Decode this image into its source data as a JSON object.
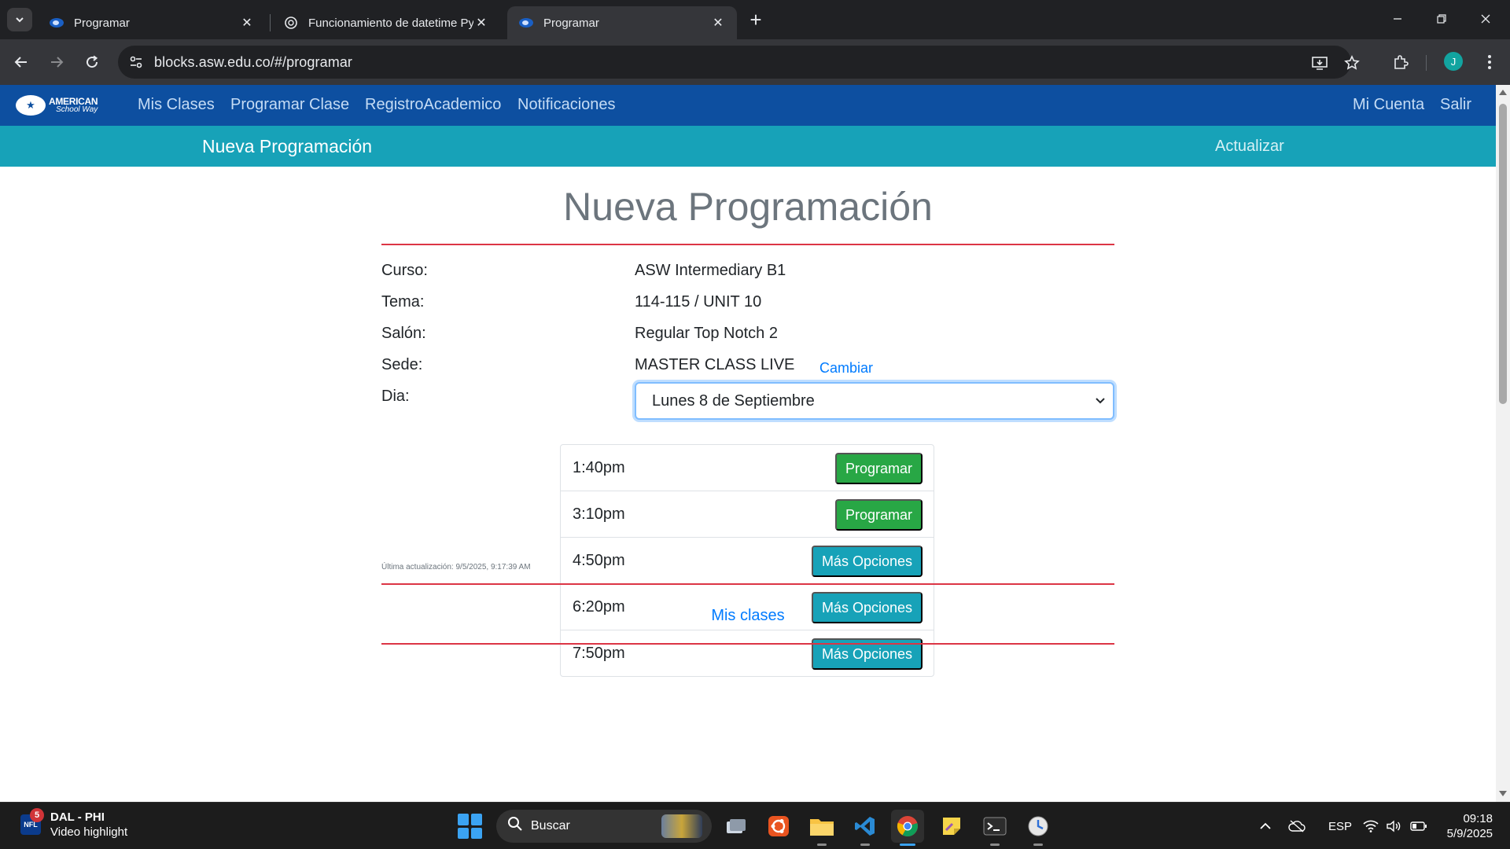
{
  "browser": {
    "tabs": [
      {
        "title": "Programar",
        "icon": "asw-logo-icon",
        "active": false
      },
      {
        "title": "Funcionamiento de datetime Py",
        "icon": "chatgpt-icon",
        "active": false
      },
      {
        "title": "Programar",
        "icon": "asw-logo-icon",
        "active": true
      }
    ],
    "url": "blocks.asw.edu.co/#/programar",
    "profile_initial": "J"
  },
  "site": {
    "logo": {
      "line1": "AMERICAN",
      "line2": "School Way"
    },
    "nav": [
      "Mis Clases",
      "Programar Clase",
      "RegistroAcademico",
      "Notificaciones"
    ],
    "nav_right": [
      "Mi Cuenta",
      "Salir"
    ],
    "subnav_title": "Nueva Programación",
    "subnav_action": "Actualizar"
  },
  "form": {
    "heading": "Nueva Programación",
    "fields": [
      {
        "label": "Curso:",
        "value": "ASW Intermediary B1"
      },
      {
        "label": "Tema:",
        "value": "114-115 / UNIT 10"
      },
      {
        "label": "Salón:",
        "value": "Regular Top Notch 2"
      },
      {
        "label": "Sede:",
        "value": "MASTER CLASS LIVE"
      }
    ],
    "change_link": "Cambiar",
    "day_label": "Dia:",
    "day_selected": "Lunes 8 de Septiembre",
    "slots": [
      {
        "time": "1:40pm",
        "action": "Programar",
        "kind": "success"
      },
      {
        "time": "3:10pm",
        "action": "Programar",
        "kind": "success"
      },
      {
        "time": "4:50pm",
        "action": "Más Opciones",
        "kind": "info"
      },
      {
        "time": "6:20pm",
        "action": "Más Opciones",
        "kind": "info"
      },
      {
        "time": "7:50pm",
        "action": "Más Opciones",
        "kind": "info"
      }
    ],
    "last_update": "Última actualización: 9/5/2025, 9:17:39 AM",
    "footer_link": "Mis clases"
  },
  "taskbar": {
    "widget": {
      "badge": "5",
      "icon_text": "NFL",
      "title": "DAL - PHI",
      "subtitle": "Video highlight"
    },
    "search_placeholder": "Buscar",
    "apps": [
      "task-view-icon",
      "ubuntu-icon",
      "file-explorer-icon",
      "vscode-icon",
      "chrome-icon",
      "sticky-notes-icon",
      "terminal-icon",
      "clock-app-icon"
    ],
    "tray": {
      "language": "ESP",
      "time": "09:18",
      "date": "5/9/2025"
    }
  },
  "colors": {
    "nav_blue": "#0d4fa0",
    "subnav_teal": "#17a2b8",
    "success_green": "#28a745",
    "rule_red": "#dc3545",
    "link_blue": "#007bff"
  }
}
